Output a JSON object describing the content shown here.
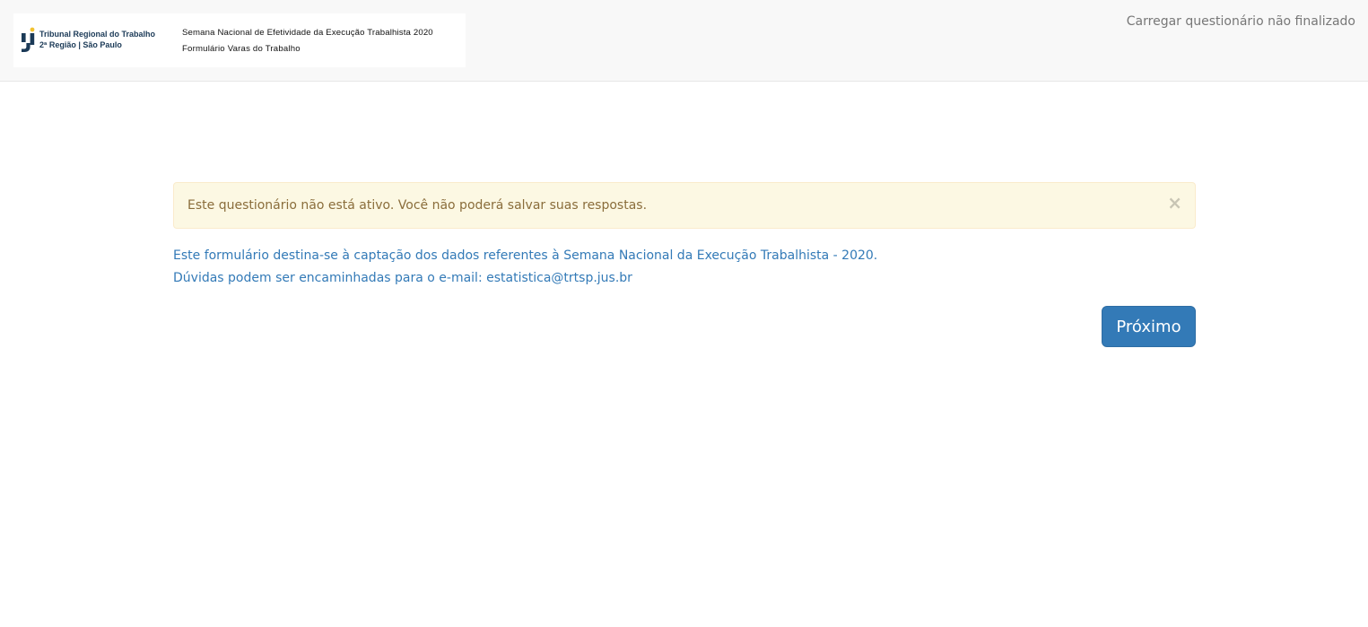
{
  "header": {
    "org_line1": "Tribunal Regional do Trabalho",
    "org_line2": "2ª Região | São Paulo",
    "form_title": "Semana Nacional de Efetividade da Execução Trabalhista 2020",
    "form_subtitle": "Formulário Varas do Trabalho",
    "load_unfinished_label": "Carregar questionário não finalizado"
  },
  "alert": {
    "message": "Este questionário não está ativo. Você não poderá salvar suas respostas.",
    "close_glyph": "×"
  },
  "intro": {
    "line1": "Este formulário destina-se à captação dos dados referentes à Semana Nacional da Execução Trabalhista - 2020.",
    "line2": "Dúvidas podem ser encaminhadas para o e-mail: estatistica@trtsp.jus.br"
  },
  "actions": {
    "next_label": "Próximo"
  },
  "colors": {
    "navbar_bg": "#f8f8f8",
    "alert_bg": "#fcf8e3",
    "alert_text": "#8a6d3b",
    "link_blue": "#337ab7",
    "logo_yellow": "#f2c230",
    "logo_navy": "#1b3a57"
  }
}
